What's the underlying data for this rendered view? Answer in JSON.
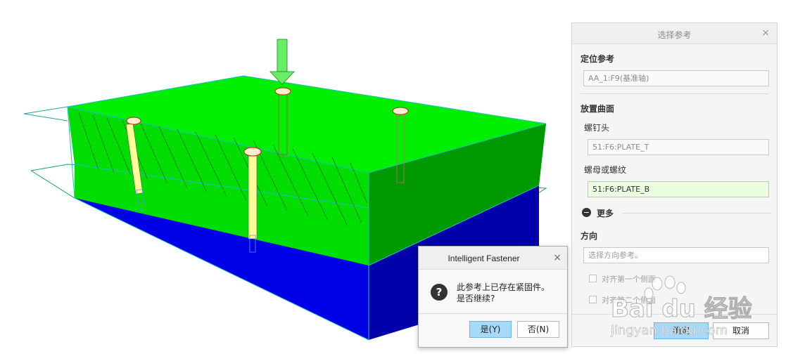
{
  "panel": {
    "title": "选择参考",
    "close_icon": "×",
    "section_locate": "定位参考",
    "locate_value": "AA_1:F9(基准轴)",
    "section_surface": "放置曲面",
    "screw_head_label": "螺钉头",
    "screw_head_value": "51:F6:PLATE_T",
    "nut_label": "螺母或螺纹",
    "nut_value": "51:F6:PLATE_B",
    "more_label": "更多",
    "section_direction": "方向",
    "direction_placeholder": "选择方向参考。",
    "check1_label": "对齐第一个侧面",
    "check2_label": "对齐第二个侧面",
    "ok_label": "确定",
    "cancel_label": "取消"
  },
  "dialog": {
    "title": "Intelligent Fastener",
    "close_icon": "×",
    "message_line1": "此参考上已存在紧固件。",
    "message_line2": "是否继续?",
    "yes_label": "是(Y)",
    "no_label": "否(N)",
    "question_icon": "?"
  },
  "watermark": {
    "brand": "Bai du 经验",
    "url": "jingyan.baidu.com"
  },
  "colors": {
    "plate_top": "#00e800",
    "plate_bottom": "#0000e8",
    "field_active": "#ebfde0",
    "button_primary": "#a7dafa"
  }
}
